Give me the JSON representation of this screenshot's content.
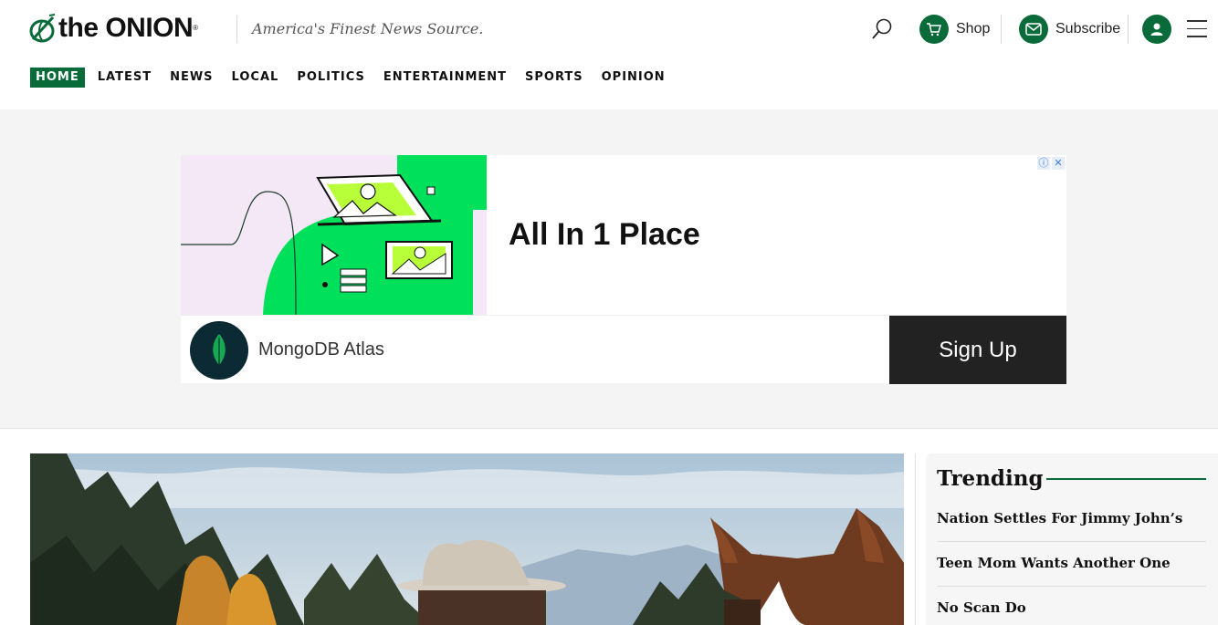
{
  "header": {
    "logo_text": "the ONION",
    "logo_reg": "®",
    "tagline": "America's Finest News Source.",
    "shop_label": "Shop",
    "subscribe_label": "Subscribe",
    "accent_color": "#0a6b3a"
  },
  "nav": {
    "items": [
      {
        "label": "HOME",
        "active": true
      },
      {
        "label": "LATEST"
      },
      {
        "label": "NEWS"
      },
      {
        "label": "LOCAL"
      },
      {
        "label": "POLITICS"
      },
      {
        "label": "ENTERTAINMENT"
      },
      {
        "label": "SPORTS"
      },
      {
        "label": "OPINION"
      }
    ]
  },
  "ad": {
    "headline": "All In 1 Place",
    "brand": "MongoDB Atlas",
    "cta": "Sign Up",
    "info_icon": "info-icon",
    "close_icon": "close-icon"
  },
  "trending": {
    "title": "Trending",
    "items": [
      "Nation Settles For Jimmy John’s",
      "Teen Mom Wants Another One",
      "No Scan Do"
    ]
  }
}
